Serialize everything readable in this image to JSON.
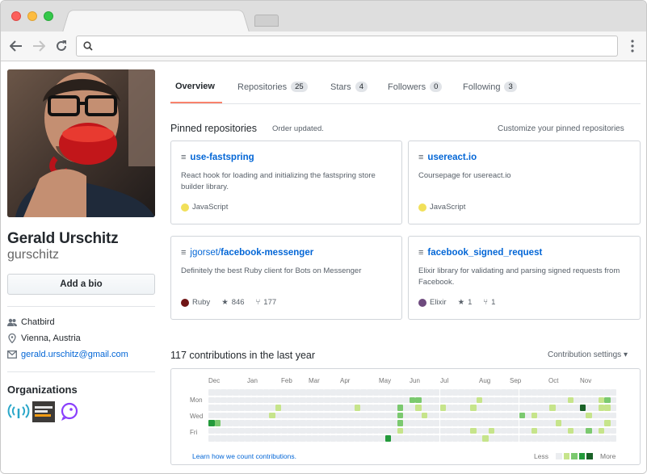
{
  "browser": {
    "address_value": "",
    "icons": [
      "back-arrow-icon",
      "forward-arrow-icon",
      "reload-icon",
      "search-icon",
      "kebab-menu-icon"
    ]
  },
  "profile": {
    "name": "Gerald Urschitz",
    "login": "gurschitz",
    "bio_button": "Add a bio",
    "company": "Chatbird",
    "location": "Vienna, Austria",
    "email": "gerald.urschitz@gmail.com",
    "organizations_heading": "Organizations",
    "organizations": [
      {
        "name": "wifi-org",
        "color": "#2aa7c9"
      },
      {
        "name": "smartmenu-org",
        "color": "#3a3a3a"
      },
      {
        "name": "chat-org",
        "color": "#8a3ffc"
      }
    ]
  },
  "tabs": [
    {
      "label": "Overview",
      "count": null,
      "selected": true
    },
    {
      "label": "Repositories",
      "count": "25",
      "selected": false
    },
    {
      "label": "Stars",
      "count": "4",
      "selected": false
    },
    {
      "label": "Followers",
      "count": "0",
      "selected": false
    },
    {
      "label": "Following",
      "count": "3",
      "selected": false
    }
  ],
  "pinned": {
    "heading": "Pinned repositories",
    "status": "Order updated.",
    "customize": "Customize your pinned repositories",
    "repos": [
      {
        "owner": "",
        "name": "use-fastspring",
        "description": "React hook for loading and initializing the fastspring store builder library.",
        "language": "JavaScript",
        "lang_color": "#f1e05a",
        "stars": "",
        "forks": ""
      },
      {
        "owner": "",
        "name": "usereact.io",
        "description": "Coursepage for usereact.io",
        "language": "JavaScript",
        "lang_color": "#f1e05a",
        "stars": "",
        "forks": ""
      },
      {
        "owner": "jgorset/",
        "name": "facebook-messenger",
        "description": "Definitely the best Ruby client for Bots on Messenger",
        "language": "Ruby",
        "lang_color": "#701516",
        "stars": "846",
        "forks": "177"
      },
      {
        "owner": "",
        "name": "facebook_signed_request",
        "description": "Elixir library for validating and parsing signed requests from Facebook.",
        "language": "Elixir",
        "lang_color": "#6e4a7e",
        "stars": "1",
        "forks": "1"
      }
    ]
  },
  "contributions": {
    "heading": "117 contributions in the last year",
    "settings": "Contribution settings",
    "months": [
      "Dec",
      "Jan",
      "Feb",
      "Mar",
      "Apr",
      "May",
      "Jun",
      "Jul",
      "Aug",
      "Sep",
      "Oct",
      "Nov"
    ],
    "weekdays": [
      "Mon",
      "Wed",
      "Fri"
    ],
    "learn_link": "Learn how we count contributions.",
    "legend_less": "Less",
    "legend_more": "More",
    "legend_colors": [
      "#ebedf0",
      "#c6e48b",
      "#7bc96f",
      "#239a3b",
      "#196127"
    ],
    "active_cells": [
      [
        0,
        4,
        3
      ],
      [
        1,
        4,
        2
      ],
      [
        10,
        3,
        1
      ],
      [
        11,
        2,
        1
      ],
      [
        24,
        2,
        1
      ],
      [
        31,
        2,
        2
      ],
      [
        31,
        3,
        2
      ],
      [
        31,
        4,
        2
      ],
      [
        31,
        5,
        1
      ],
      [
        29,
        6,
        3
      ],
      [
        34,
        1,
        2
      ],
      [
        34,
        2,
        1
      ],
      [
        33,
        1,
        2
      ],
      [
        35,
        3,
        1
      ],
      [
        38,
        2,
        1
      ],
      [
        43,
        2,
        1
      ],
      [
        43,
        5,
        1
      ],
      [
        44,
        1,
        1
      ],
      [
        46,
        5,
        1
      ],
      [
        45,
        6,
        1
      ],
      [
        51,
        3,
        2
      ],
      [
        53,
        3,
        1
      ],
      [
        53,
        5,
        1
      ],
      [
        56,
        2,
        1
      ],
      [
        57,
        4,
        1
      ],
      [
        59,
        1,
        1
      ],
      [
        59,
        5,
        1
      ],
      [
        61,
        2,
        4
      ],
      [
        62,
        3,
        1
      ],
      [
        62,
        5,
        2
      ],
      [
        64,
        1,
        1
      ],
      [
        64,
        2,
        1
      ],
      [
        65,
        1,
        2
      ],
      [
        65,
        2,
        1
      ],
      [
        65,
        4,
        1
      ],
      [
        64,
        5,
        1
      ]
    ]
  }
}
